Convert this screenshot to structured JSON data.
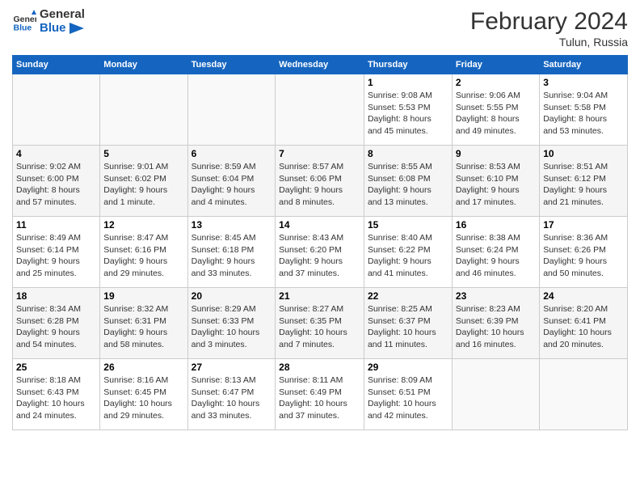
{
  "header": {
    "logo_line1": "General",
    "logo_line2": "Blue",
    "month_title": "February 2024",
    "location": "Tulun, Russia"
  },
  "days_of_week": [
    "Sunday",
    "Monday",
    "Tuesday",
    "Wednesday",
    "Thursday",
    "Friday",
    "Saturday"
  ],
  "weeks": [
    [
      {
        "day": "",
        "info": ""
      },
      {
        "day": "",
        "info": ""
      },
      {
        "day": "",
        "info": ""
      },
      {
        "day": "",
        "info": ""
      },
      {
        "day": "1",
        "info": "Sunrise: 9:08 AM\nSunset: 5:53 PM\nDaylight: 8 hours\nand 45 minutes."
      },
      {
        "day": "2",
        "info": "Sunrise: 9:06 AM\nSunset: 5:55 PM\nDaylight: 8 hours\nand 49 minutes."
      },
      {
        "day": "3",
        "info": "Sunrise: 9:04 AM\nSunset: 5:58 PM\nDaylight: 8 hours\nand 53 minutes."
      }
    ],
    [
      {
        "day": "4",
        "info": "Sunrise: 9:02 AM\nSunset: 6:00 PM\nDaylight: 8 hours\nand 57 minutes."
      },
      {
        "day": "5",
        "info": "Sunrise: 9:01 AM\nSunset: 6:02 PM\nDaylight: 9 hours\nand 1 minute."
      },
      {
        "day": "6",
        "info": "Sunrise: 8:59 AM\nSunset: 6:04 PM\nDaylight: 9 hours\nand 4 minutes."
      },
      {
        "day": "7",
        "info": "Sunrise: 8:57 AM\nSunset: 6:06 PM\nDaylight: 9 hours\nand 8 minutes."
      },
      {
        "day": "8",
        "info": "Sunrise: 8:55 AM\nSunset: 6:08 PM\nDaylight: 9 hours\nand 13 minutes."
      },
      {
        "day": "9",
        "info": "Sunrise: 8:53 AM\nSunset: 6:10 PM\nDaylight: 9 hours\nand 17 minutes."
      },
      {
        "day": "10",
        "info": "Sunrise: 8:51 AM\nSunset: 6:12 PM\nDaylight: 9 hours\nand 21 minutes."
      }
    ],
    [
      {
        "day": "11",
        "info": "Sunrise: 8:49 AM\nSunset: 6:14 PM\nDaylight: 9 hours\nand 25 minutes."
      },
      {
        "day": "12",
        "info": "Sunrise: 8:47 AM\nSunset: 6:16 PM\nDaylight: 9 hours\nand 29 minutes."
      },
      {
        "day": "13",
        "info": "Sunrise: 8:45 AM\nSunset: 6:18 PM\nDaylight: 9 hours\nand 33 minutes."
      },
      {
        "day": "14",
        "info": "Sunrise: 8:43 AM\nSunset: 6:20 PM\nDaylight: 9 hours\nand 37 minutes."
      },
      {
        "day": "15",
        "info": "Sunrise: 8:40 AM\nSunset: 6:22 PM\nDaylight: 9 hours\nand 41 minutes."
      },
      {
        "day": "16",
        "info": "Sunrise: 8:38 AM\nSunset: 6:24 PM\nDaylight: 9 hours\nand 46 minutes."
      },
      {
        "day": "17",
        "info": "Sunrise: 8:36 AM\nSunset: 6:26 PM\nDaylight: 9 hours\nand 50 minutes."
      }
    ],
    [
      {
        "day": "18",
        "info": "Sunrise: 8:34 AM\nSunset: 6:28 PM\nDaylight: 9 hours\nand 54 minutes."
      },
      {
        "day": "19",
        "info": "Sunrise: 8:32 AM\nSunset: 6:31 PM\nDaylight: 9 hours\nand 58 minutes."
      },
      {
        "day": "20",
        "info": "Sunrise: 8:29 AM\nSunset: 6:33 PM\nDaylight: 10 hours\nand 3 minutes."
      },
      {
        "day": "21",
        "info": "Sunrise: 8:27 AM\nSunset: 6:35 PM\nDaylight: 10 hours\nand 7 minutes."
      },
      {
        "day": "22",
        "info": "Sunrise: 8:25 AM\nSunset: 6:37 PM\nDaylight: 10 hours\nand 11 minutes."
      },
      {
        "day": "23",
        "info": "Sunrise: 8:23 AM\nSunset: 6:39 PM\nDaylight: 10 hours\nand 16 minutes."
      },
      {
        "day": "24",
        "info": "Sunrise: 8:20 AM\nSunset: 6:41 PM\nDaylight: 10 hours\nand 20 minutes."
      }
    ],
    [
      {
        "day": "25",
        "info": "Sunrise: 8:18 AM\nSunset: 6:43 PM\nDaylight: 10 hours\nand 24 minutes."
      },
      {
        "day": "26",
        "info": "Sunrise: 8:16 AM\nSunset: 6:45 PM\nDaylight: 10 hours\nand 29 minutes."
      },
      {
        "day": "27",
        "info": "Sunrise: 8:13 AM\nSunset: 6:47 PM\nDaylight: 10 hours\nand 33 minutes."
      },
      {
        "day": "28",
        "info": "Sunrise: 8:11 AM\nSunset: 6:49 PM\nDaylight: 10 hours\nand 37 minutes."
      },
      {
        "day": "29",
        "info": "Sunrise: 8:09 AM\nSunset: 6:51 PM\nDaylight: 10 hours\nand 42 minutes."
      },
      {
        "day": "",
        "info": ""
      },
      {
        "day": "",
        "info": ""
      }
    ]
  ]
}
